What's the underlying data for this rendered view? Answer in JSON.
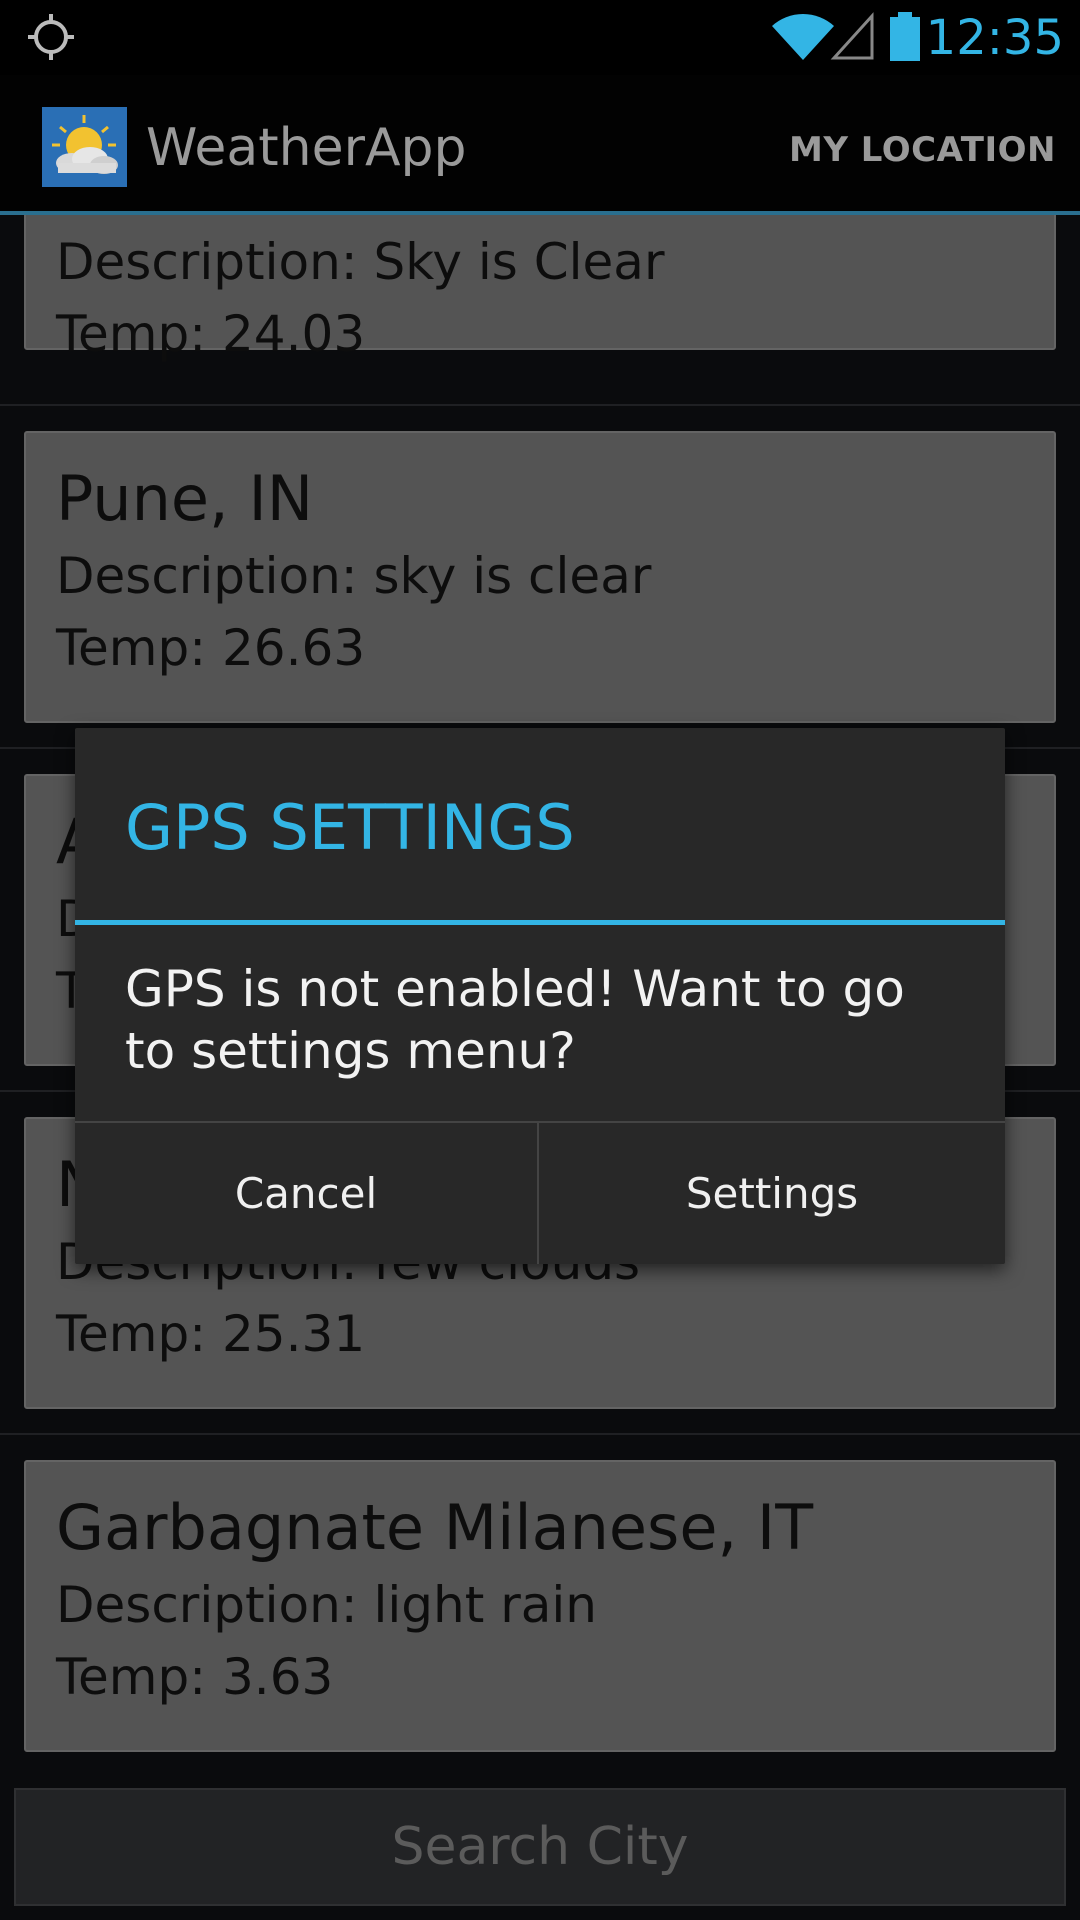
{
  "status_bar": {
    "time": "12:35",
    "left_icon": "gps-icon",
    "icons": [
      "wifi-icon",
      "signal-icon",
      "battery-icon"
    ],
    "accent_color": "#33b5e5"
  },
  "action_bar": {
    "logo_icon": "weather-logo-icon",
    "title": "WeatherApp",
    "action_label": "MY LOCATION"
  },
  "cities": [
    {
      "city": "",
      "description": "Description: Sky is Clear",
      "temp": "Temp: 24.03"
    },
    {
      "city": "Pune, IN",
      "description": "Description: sky is clear",
      "temp": "Temp: 26.63"
    },
    {
      "city": "A",
      "description": "D",
      "temp": "T"
    },
    {
      "city": "N",
      "description": "Description: few clouds",
      "temp": "Temp: 25.31"
    },
    {
      "city": "Garbagnate Milanese, IT",
      "description": "Description: light rain",
      "temp": "Temp: 3.63"
    }
  ],
  "search": {
    "label": "Search City"
  },
  "dialog": {
    "title": "GPS SETTINGS",
    "message": "GPS is not enabled! Want to go to settings menu?",
    "cancel_label": "Cancel",
    "settings_label": "Settings"
  }
}
